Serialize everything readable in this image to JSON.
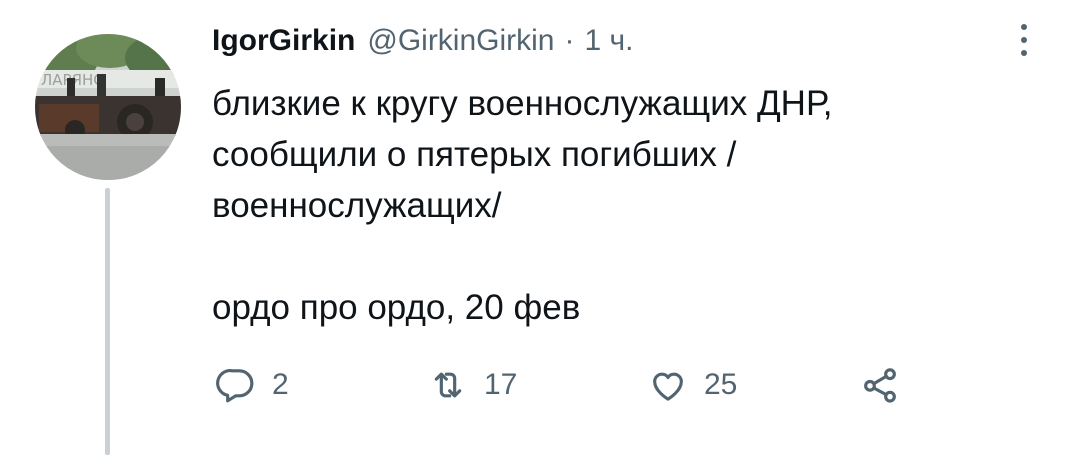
{
  "tweet": {
    "author_name": "IgorGirkin",
    "author_handle": "@GirkinGirkin",
    "separator": "·",
    "time": "1 ч.",
    "body_lines": [
      "близкие к кругу военнослужащих ДНР,",
      "сообщили о пятерых погибших /",
      "военнослужащих/"
    ],
    "body_line_2": "ордо про ордо, 20 фев",
    "avatar_sign_text": "ЛАРЯНС"
  },
  "actions": {
    "reply": {
      "icon": "reply-icon",
      "count": "2"
    },
    "retweet": {
      "icon": "retweet-icon",
      "count": "17"
    },
    "like": {
      "icon": "heart-icon",
      "count": "25"
    },
    "share": {
      "icon": "share-icon"
    }
  },
  "colors": {
    "text": "#0f1419",
    "secondary": "#536471",
    "thread_line": "#c9d1d7",
    "background": "#ffffff"
  }
}
